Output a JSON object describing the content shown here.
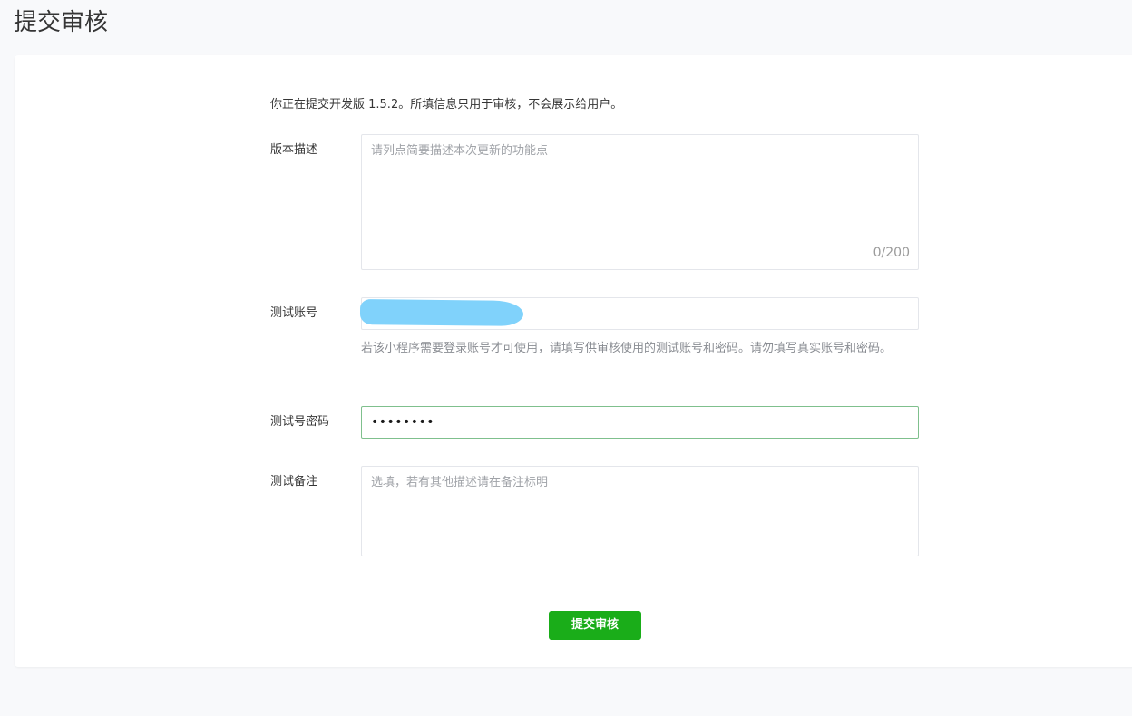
{
  "page": {
    "title": "提交审核"
  },
  "form": {
    "notice": "你正在提交开发版 1.5.2。所填信息只用于审核，不会展示给用户。",
    "version_description": {
      "label": "版本描述",
      "placeholder": "请列点简要描述本次更新的功能点",
      "counter": "0/200"
    },
    "test_account": {
      "label": "测试账号",
      "value": "",
      "help": "若该小程序需要登录账号才可使用，请填写供审核使用的测试账号和密码。请勿填写真实账号和密码。"
    },
    "test_password": {
      "label": "测试号密码",
      "value": "••••••••"
    },
    "test_notes": {
      "label": "测试备注",
      "placeholder": "选填，若有其他描述请在备注标明"
    },
    "submit_label": "提交审核"
  },
  "colors": {
    "primary_button": "#1aad19",
    "focus_border": "#7fc08d",
    "redaction": "#80d2fb"
  }
}
